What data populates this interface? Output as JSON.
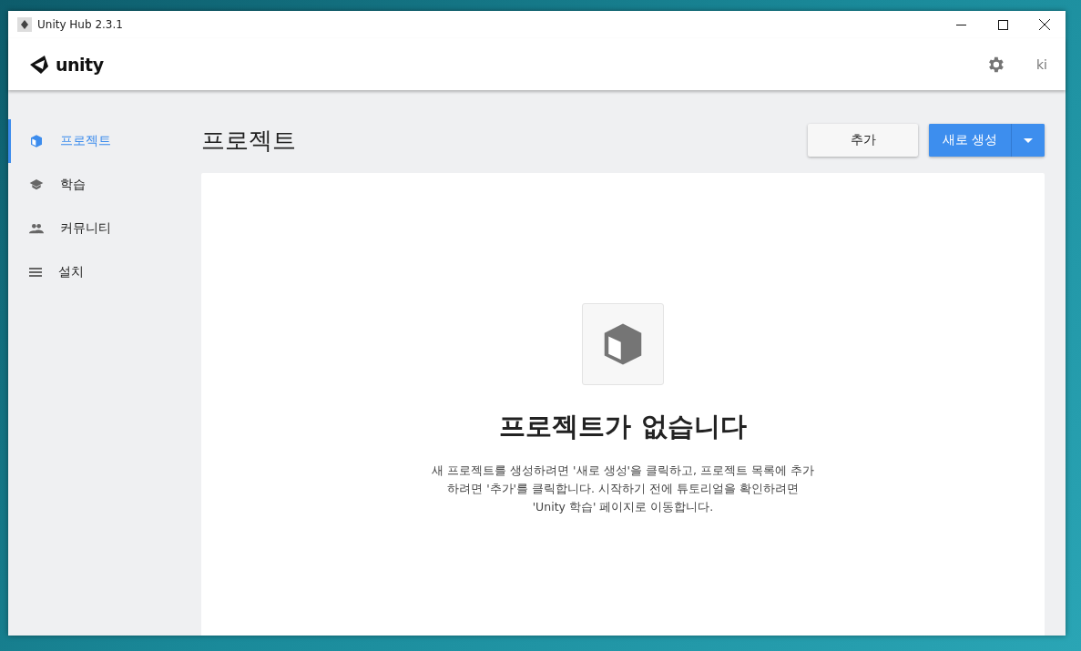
{
  "window": {
    "title": "Unity Hub 2.3.1"
  },
  "header": {
    "logo_text": "unity",
    "user_initials": "ki"
  },
  "sidebar": {
    "items": [
      {
        "label": "프로젝트",
        "kind": "cube",
        "selected": true
      },
      {
        "label": "학습",
        "kind": "learn",
        "selected": false
      },
      {
        "label": "커뮤니티",
        "kind": "community",
        "selected": false
      },
      {
        "label": "설치",
        "kind": "installs",
        "selected": false
      }
    ]
  },
  "page": {
    "title": "프로젝트",
    "add_button": "추가",
    "new_button": "새로 생성"
  },
  "empty_state": {
    "title": "프로젝트가 없습니다",
    "message": "새 프로젝트를 생성하려면 '새로 생성'을 클릭하고, 프로젝트 목록에 추가하려면 '추가'를 클릭합니다. 시작하기 전에 튜토리얼을 확인하려면 'Unity 학습' 페이지로 이동합니다."
  }
}
